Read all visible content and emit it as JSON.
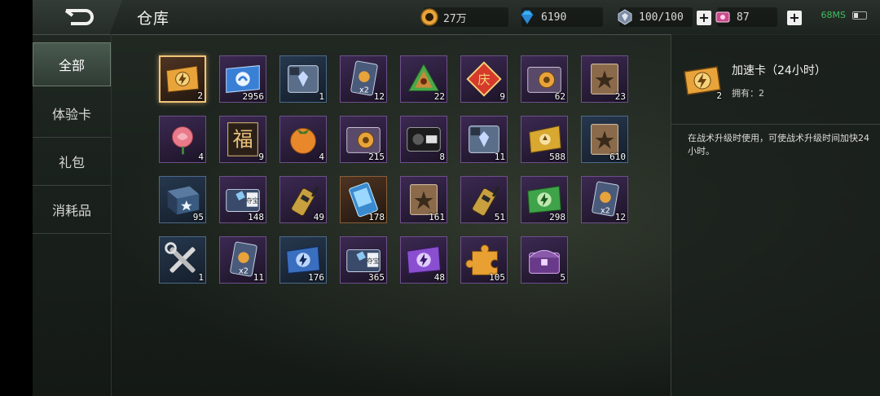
{
  "header": {
    "title": "仓库"
  },
  "resources": {
    "gold": {
      "value": "27万",
      "icon": "gold-coin-icon"
    },
    "diamond": {
      "value": "6190",
      "icon": "diamond-icon"
    },
    "energy": {
      "value": "100/100",
      "icon": "energy-gem-icon"
    },
    "ticket": {
      "value": "87",
      "icon": "ticket-icon"
    }
  },
  "status": {
    "network": "68MS"
  },
  "sidebar": {
    "items": [
      {
        "label": "全部",
        "active": true
      },
      {
        "label": "体验卡",
        "active": false
      },
      {
        "label": "礼包",
        "active": false
      },
      {
        "label": "消耗品",
        "active": false
      }
    ]
  },
  "items": [
    {
      "name": "speedup-card-24h",
      "count": "2",
      "icon": "gold-lightning-card-icon",
      "rarity": "orange",
      "selected": true
    },
    {
      "name": "blue-card",
      "count": "2956",
      "icon": "blue-card-icon",
      "rarity": "purple"
    },
    {
      "name": "agreement-diamond",
      "count": "1",
      "icon": "agreement-diamond-icon",
      "rarity": "blue"
    },
    {
      "name": "double-card",
      "count": "12",
      "icon": "double-card-icon",
      "rarity": "purple"
    },
    {
      "name": "zongzi",
      "count": "22",
      "icon": "zongzi-icon",
      "rarity": "purple"
    },
    {
      "name": "celebration-charm",
      "count": "9",
      "icon": "celebration-charm-icon",
      "rarity": "purple"
    },
    {
      "name": "contract-coin",
      "count": "62",
      "icon": "contract-coin-icon",
      "rarity": "purple"
    },
    {
      "name": "star-book-brown",
      "count": "23",
      "icon": "star-book-icon",
      "rarity": "purple"
    },
    {
      "name": "rose",
      "count": "4",
      "icon": "rose-icon",
      "rarity": "purple"
    },
    {
      "name": "fu-charm",
      "count": "9",
      "icon": "fu-charm-icon",
      "rarity": "purple"
    },
    {
      "name": "persimmon",
      "count": "4",
      "icon": "persimmon-icon",
      "rarity": "purple"
    },
    {
      "name": "contract-coin-gold",
      "count": "215",
      "icon": "contract-coin-icon",
      "rarity": "purple"
    },
    {
      "name": "recruit-card",
      "count": "8",
      "icon": "recruit-card-icon",
      "rarity": "purple"
    },
    {
      "name": "agreement-diamond-gold",
      "count": "11",
      "icon": "agreement-diamond-icon",
      "rarity": "purple"
    },
    {
      "name": "gold-ticket",
      "count": "588",
      "icon": "gold-ticket-icon",
      "rarity": "purple"
    },
    {
      "name": "star-book-blue",
      "count": "610",
      "icon": "star-book-icon",
      "rarity": "blue"
    },
    {
      "name": "star-crate",
      "count": "95",
      "icon": "star-crate-icon",
      "rarity": "blue"
    },
    {
      "name": "treasure-blue",
      "count": "148",
      "icon": "treasure-box-icon",
      "rarity": "purple"
    },
    {
      "name": "radio-gold",
      "count": "49",
      "icon": "walkie-talkie-icon",
      "rarity": "purple"
    },
    {
      "name": "phone-card",
      "count": "178",
      "icon": "phone-card-icon",
      "rarity": "orange"
    },
    {
      "name": "star-book-bronze",
      "count": "161",
      "icon": "star-book-icon",
      "rarity": "purple"
    },
    {
      "name": "radio-black",
      "count": "51",
      "icon": "walkie-talkie-icon",
      "rarity": "purple"
    },
    {
      "name": "green-card",
      "count": "298",
      "icon": "green-lightning-card-icon",
      "rarity": "purple"
    },
    {
      "name": "double-coin-card",
      "count": "12",
      "icon": "double-card-icon",
      "rarity": "purple"
    },
    {
      "name": "repair-tools",
      "count": "1",
      "icon": "wrench-icon",
      "rarity": "blue"
    },
    {
      "name": "double-card-small",
      "count": "11",
      "icon": "double-card-icon",
      "rarity": "purple"
    },
    {
      "name": "blue-lightning-card",
      "count": "176",
      "icon": "blue-lightning-card-icon",
      "rarity": "blue"
    },
    {
      "name": "treasure-gold",
      "count": "365",
      "icon": "treasure-box-icon",
      "rarity": "purple"
    },
    {
      "name": "purple-lightning-card",
      "count": "48",
      "icon": "purple-lightning-card-icon",
      "rarity": "purple"
    },
    {
      "name": "puzzle-piece",
      "count": "105",
      "icon": "puzzle-piece-icon",
      "rarity": "purple"
    },
    {
      "name": "purple-chest",
      "count": "5",
      "icon": "chest-icon",
      "rarity": "purple"
    }
  ],
  "detail": {
    "name": "加速卡（24小时）",
    "owned": "拥有：2",
    "icon_count": "2",
    "description": "在战术升级时使用，可使战术升级时间加快24小时。"
  },
  "colors": {
    "gold": "#e8a33a",
    "blue": "#3a7fd6",
    "green": "#3fa34a",
    "purple": "#8a4fd0",
    "selected_border": "#f1c47a"
  }
}
